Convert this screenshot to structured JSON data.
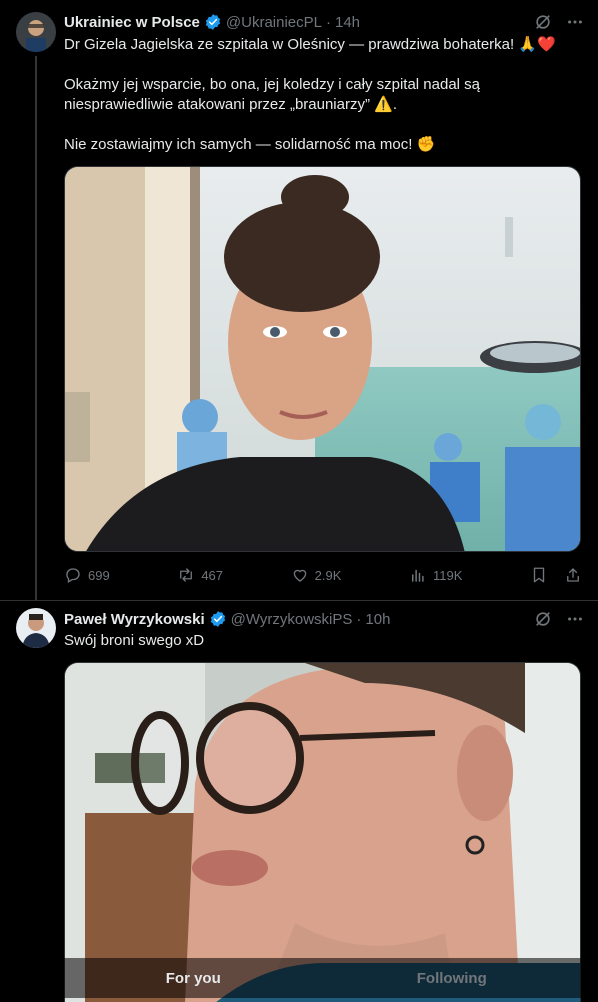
{
  "tweet1": {
    "display_name": "Ukrainiec w Polsce",
    "handle": "@UkrainiecPL",
    "dot": "·",
    "time": "14h",
    "line1": "Dr Gizela Jagielska ze szpitala w Oleśnicy — prawdziwa bohaterka! 🙏❤️",
    "line2": "Okażmy jej wsparcie, bo ona, jej koledzy i cały szpital nadal są niesprawiedliwie atakowani przez „brauniarzy” ⚠️.",
    "line3": "Nie zostawiajmy ich samych — solidarność ma moc! ✊",
    "replies": "699",
    "reposts": "467",
    "likes": "2.9K",
    "views": "119K"
  },
  "tweet2": {
    "display_name": "Paweł Wyrzykowski",
    "handle": "@WyrzykowskiPS",
    "dot": "·",
    "time": "10h",
    "text": "Swój broni swego xD"
  },
  "tabs": {
    "for_you": "For you",
    "following": "Following"
  },
  "colors": {
    "verified": "#1d9bf0",
    "background": "#000000",
    "muted": "#71767b"
  }
}
